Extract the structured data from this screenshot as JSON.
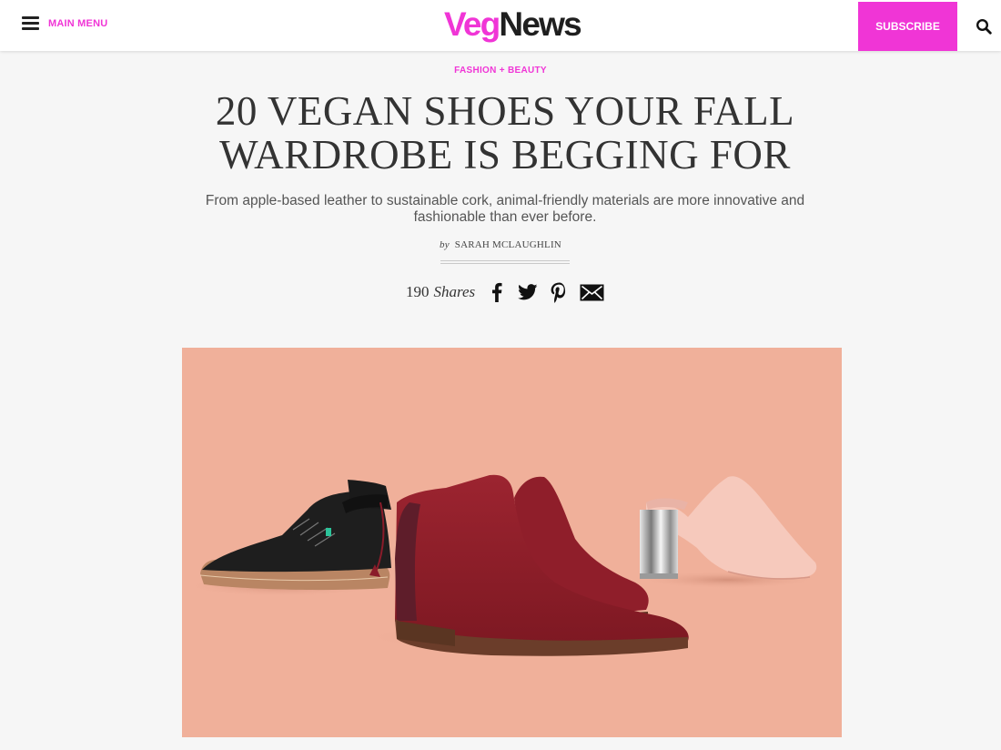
{
  "header": {
    "menu_label": "MAIN MENU",
    "logo_part1": "Veg",
    "logo_part2": "News",
    "subscribe_label": "SUBSCRIBE",
    "search_icon": "search-icon",
    "menu_icon": "hamburger-menu-icon"
  },
  "article": {
    "category": "FASHION + BEAUTY",
    "title_line1": "20 VEGAN SHOES YOUR FALL",
    "title_line2": "WARDROBE IS BEGGING FOR",
    "dek": "From apple-based leather to sustainable cork, animal-friendly materials are more innovative and fashionable than ever before.",
    "byline_prefix": "by",
    "author": "SARAH MCLAUGHLIN",
    "share_count": "190",
    "share_label": "Shares",
    "share_icons": [
      "facebook-icon",
      "twitter-icon",
      "pinterest-icon",
      "email-icon"
    ]
  },
  "colors": {
    "brand_pink": "#f035d6",
    "hero_background": "#f0b09a",
    "text_dark": "#333333"
  }
}
